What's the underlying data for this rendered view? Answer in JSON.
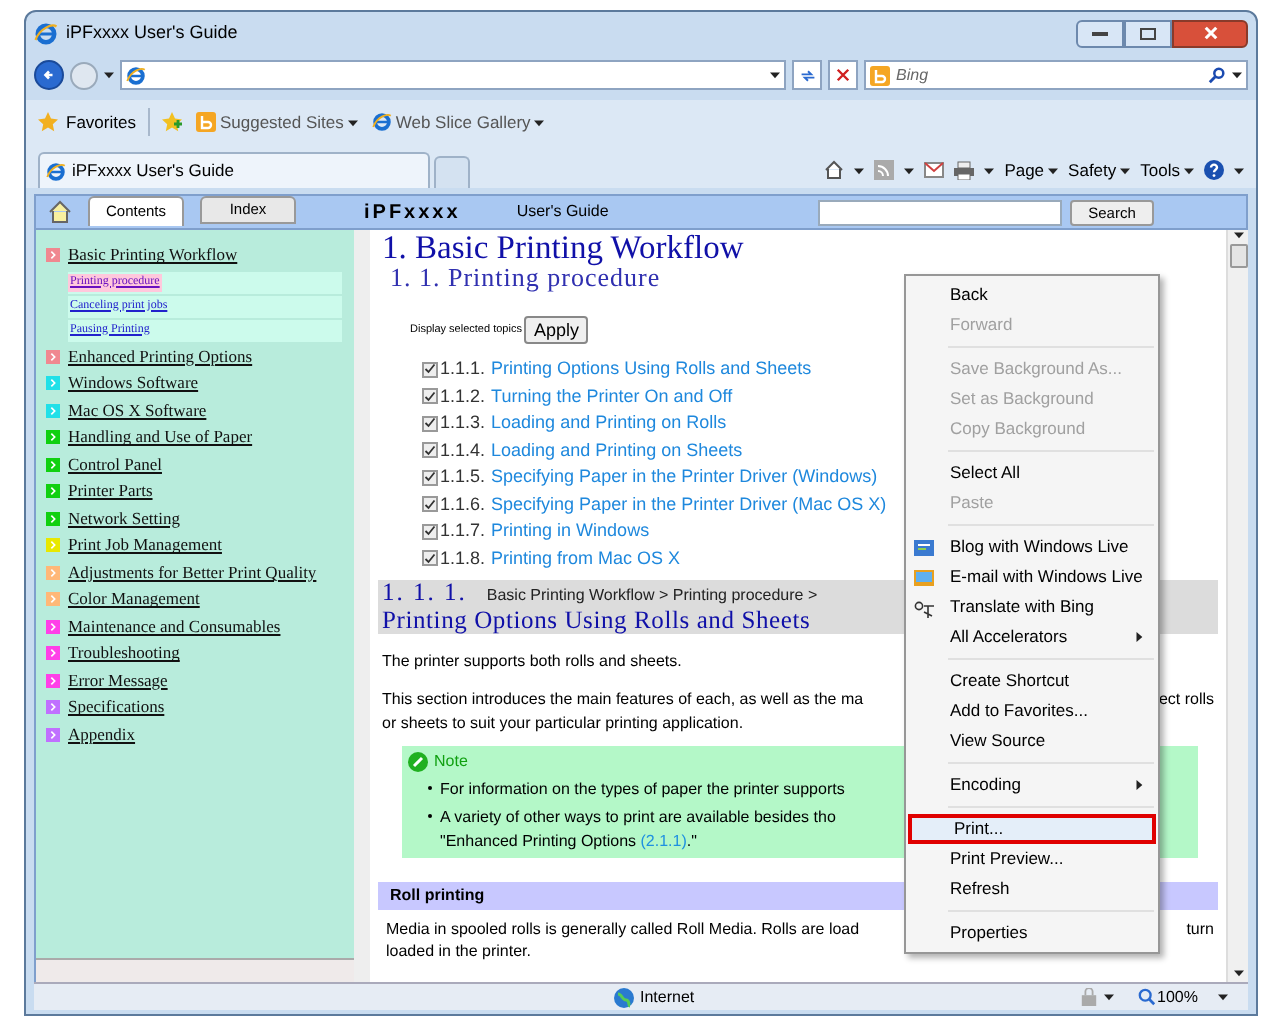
{
  "window": {
    "title": "iPFxxxx User's Guide"
  },
  "address_bar": {
    "search_placeholder": "Bing"
  },
  "favorites_bar": {
    "label": "Favorites",
    "links": [
      "Suggested Sites",
      "Web Slice Gallery"
    ]
  },
  "tabs": [
    {
      "label": "iPFxxxx User's Guide",
      "selected": true
    }
  ],
  "command_bar": {
    "menus": [
      "Page",
      "Safety",
      "Tools"
    ]
  },
  "help_header": {
    "tabs": [
      {
        "label": "Contents",
        "selected": true
      },
      {
        "label": "Index",
        "selected": false
      }
    ],
    "logo": "iPFxxxx",
    "subtitle": "User's Guide",
    "search_button": "Search"
  },
  "sidebar": {
    "items": [
      {
        "label": "Basic Printing Workflow",
        "color": "#f08890",
        "children": [
          {
            "label": "Printing procedure",
            "selected": true
          },
          {
            "label": "Canceling print jobs",
            "selected": false
          },
          {
            "label": "Pausing Printing",
            "selected": false
          }
        ]
      },
      {
        "label": "Enhanced Printing Options",
        "color": "#f08890"
      },
      {
        "label": "Windows Software",
        "color": "#20e0e8"
      },
      {
        "label": "Mac OS X Software",
        "color": "#20e0e8"
      },
      {
        "label": "Handling and Use of Paper",
        "color": "#10d010"
      },
      {
        "label": "Control Panel",
        "color": "#10d010"
      },
      {
        "label": "Printer Parts",
        "color": "#10d010"
      },
      {
        "label": "Network Setting",
        "color": "#10d010"
      },
      {
        "label": "Print Job Management",
        "color": "#e8e800"
      },
      {
        "label": "Adjustments for Better Print Quality",
        "color": "#ffb878"
      },
      {
        "label": "Color Management",
        "color": "#ffb878"
      },
      {
        "label": "Maintenance and Consumables",
        "color": "#ff40e8"
      },
      {
        "label": "Troubleshooting",
        "color": "#ff40e8"
      },
      {
        "label": "Error Message",
        "color": "#ff40e8"
      },
      {
        "label": "Specifications",
        "color": "#c070ff"
      },
      {
        "label": "Appendix",
        "color": "#c070ff"
      }
    ]
  },
  "content": {
    "title": "1. Basic Printing Workflow",
    "subtitle": "1. 1. Printing procedure",
    "topics_label": "Display selected topics",
    "apply_button": "Apply",
    "topics": [
      {
        "number": "1.1.1.",
        "label": "Printing Options Using Rolls and Sheets",
        "checked": true
      },
      {
        "number": "1.1.2.",
        "label": "Turning the Printer On and Off",
        "checked": true
      },
      {
        "number": "1.1.3.",
        "label": "Loading and Printing on Rolls",
        "checked": true
      },
      {
        "number": "1.1.4.",
        "label": "Loading and Printing on Sheets",
        "checked": true
      },
      {
        "number": "1.1.5.",
        "label": "Specifying Paper in the Printer Driver (Windows)",
        "checked": true
      },
      {
        "number": "1.1.6.",
        "label": "Specifying Paper in the Printer Driver (Mac OS X)",
        "checked": true
      },
      {
        "number": "1.1.7.",
        "label": "Printing in Windows",
        "checked": true
      },
      {
        "number": "1.1.8.",
        "label": "Printing from Mac OS X",
        "checked": true
      }
    ],
    "section": {
      "number": "1. 1. 1.",
      "breadcrumb": "Basic Printing Workflow > Printing procedure >",
      "title": "Printing Options Using Rolls and Sheets"
    },
    "paragraphs": [
      {
        "lines": [
          {
            "text": "The printer supports both rolls and sheets."
          }
        ]
      },
      {
        "lines": [
          {
            "text": "This section introduces the main features of each, as well as the ma",
            "after_menu": "ect rolls"
          },
          {
            "text": "or sheets to suit your particular printing application."
          }
        ]
      }
    ],
    "note": {
      "label": "Note",
      "bullets": [
        {
          "lines": [
            {
              "text": "For information on the types of paper the printer supports"
            }
          ]
        },
        {
          "lines": [
            {
              "text": "A variety of other ways to print are available besides tho"
            },
            {
              "text": "\"Enhanced Printing Options ",
              "link": "(2.1.1)",
              "tail": ".\""
            }
          ]
        }
      ]
    },
    "roll_printing": {
      "heading": "Roll printing",
      "lines": [
        {
          "text": "Media in spooled rolls is generally called Roll Media. Rolls are load",
          "after_menu": "turn"
        },
        {
          "text": "loaded in the printer."
        }
      ]
    }
  },
  "context_menu": {
    "items": [
      {
        "kind": "item",
        "label": "Back",
        "disabled": false
      },
      {
        "kind": "item",
        "label": "Forward",
        "disabled": true
      },
      {
        "kind": "separator"
      },
      {
        "kind": "item",
        "label": "Save Background As...",
        "disabled": true
      },
      {
        "kind": "item",
        "label": "Set as Background",
        "disabled": true
      },
      {
        "kind": "item",
        "label": "Copy Background",
        "disabled": true
      },
      {
        "kind": "separator"
      },
      {
        "kind": "item",
        "label": "Select All",
        "disabled": false
      },
      {
        "kind": "item",
        "label": "Paste",
        "disabled": true
      },
      {
        "kind": "separator"
      },
      {
        "kind": "blog",
        "label": "Blog with Windows Live",
        "disabled": false
      },
      {
        "kind": "email",
        "label": "E-mail with Windows Live",
        "disabled": false
      },
      {
        "kind": "translate",
        "label": "Translate with Bing",
        "disabled": false
      },
      {
        "kind": "item",
        "label": "All Accelerators",
        "disabled": false,
        "submenu": true
      },
      {
        "kind": "separator"
      },
      {
        "kind": "item",
        "label": "Create Shortcut",
        "disabled": false
      },
      {
        "kind": "item",
        "label": "Add to Favorites...",
        "disabled": false
      },
      {
        "kind": "item",
        "label": "View Source",
        "disabled": false
      },
      {
        "kind": "separator"
      },
      {
        "kind": "item",
        "label": "Encoding",
        "disabled": false,
        "submenu": true
      },
      {
        "kind": "separator"
      },
      {
        "kind": "item",
        "label": "Print...",
        "disabled": false,
        "selected": true
      },
      {
        "kind": "item",
        "label": "Print Preview...",
        "disabled": false
      },
      {
        "kind": "item",
        "label": "Refresh",
        "disabled": false
      },
      {
        "kind": "separator"
      },
      {
        "kind": "item",
        "label": "Properties",
        "disabled": false
      }
    ]
  },
  "status_bar": {
    "zone": "Internet",
    "zoom": "100%"
  }
}
